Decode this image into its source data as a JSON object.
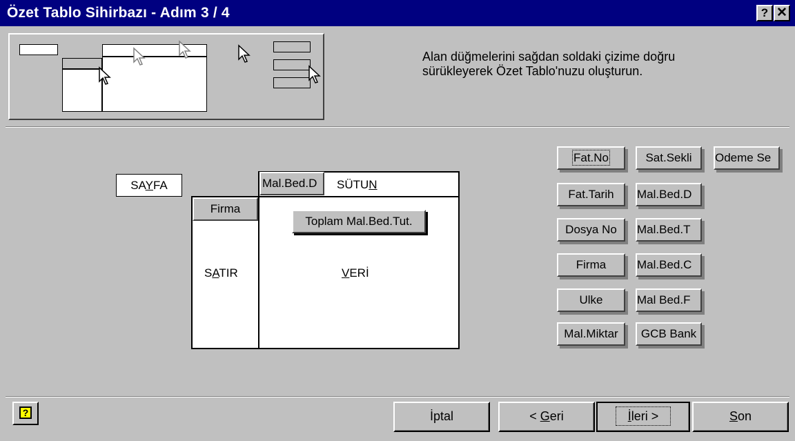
{
  "window": {
    "title": "Özet Tablo Sihirbazı - Adım 3 / 4",
    "help_glyph": "?",
    "close_glyph": "✕"
  },
  "instructions": "Alan düğmelerini sağdan soldaki çizime doğru sürükleyerek Özet Tablo'nuzu oluşturun.",
  "layout": {
    "page_label": "SAYFA",
    "page_label_pre": "SA",
    "page_label_ul": "Y",
    "page_label_post": "FA",
    "column_label_pre": "SÜTU",
    "column_label_ul": "N",
    "row_label_pre": "S",
    "row_label_ul": "A",
    "row_label_post": "TIR",
    "data_label_ul": "V",
    "data_label_post": "ERİ",
    "column_field": "Mal.Bed.D",
    "row_field": "Firma",
    "data_field": "Toplam Mal.Bed.Tut."
  },
  "fields": {
    "col1": [
      "Fat.No",
      "Fat.Tarih",
      "Dosya No",
      "Firma",
      "Ulke",
      "Mal.Miktar"
    ],
    "col2": [
      "Sat.Sekli",
      "Mal.Bed.D",
      "Mal.Bed.T",
      "Mal.Bed.C",
      "Mal Bed.F",
      "GCB Bank"
    ],
    "col3": [
      "Odeme Se"
    ]
  },
  "buttons": {
    "cancel": "İptal",
    "back_pre": "< ",
    "back_ul": "G",
    "back_post": "eri",
    "next_pre": "",
    "next_ul": "İ",
    "next_post": "leri >",
    "finish_ul": "S",
    "finish_post": "on",
    "help_glyph": "?"
  },
  "icons": [
    "help-icon",
    "close-icon",
    "pointer-cursor-icon"
  ]
}
